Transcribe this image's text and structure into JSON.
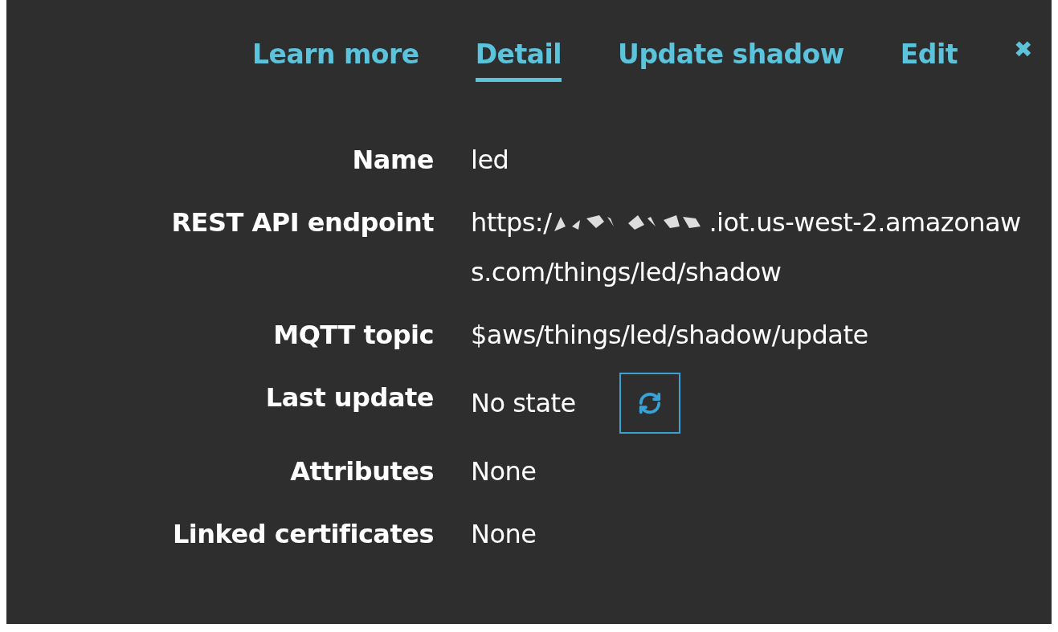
{
  "tabs": [
    {
      "label": "Learn more",
      "selected": false
    },
    {
      "label": "Detail",
      "selected": true
    },
    {
      "label": "Update shadow",
      "selected": false
    },
    {
      "label": "Edit",
      "selected": false
    }
  ],
  "close": {
    "label": "✖"
  },
  "details": [
    {
      "kind": "text",
      "label": "Name",
      "value": "led"
    },
    {
      "kind": "endpoint",
      "label": "REST API endpoint",
      "prefix": "https:/",
      "suffix": ".iot.us-west-2.amazonaws.com/things/led/shadow"
    },
    {
      "kind": "text",
      "label": "MQTT topic",
      "value": "$aws/things/led/shadow/update"
    },
    {
      "kind": "refresh",
      "label": "Last update",
      "value": "No state"
    },
    {
      "kind": "text",
      "label": "Attributes",
      "value": "None"
    },
    {
      "kind": "text",
      "label": "Linked certificates",
      "value": "None"
    }
  ]
}
